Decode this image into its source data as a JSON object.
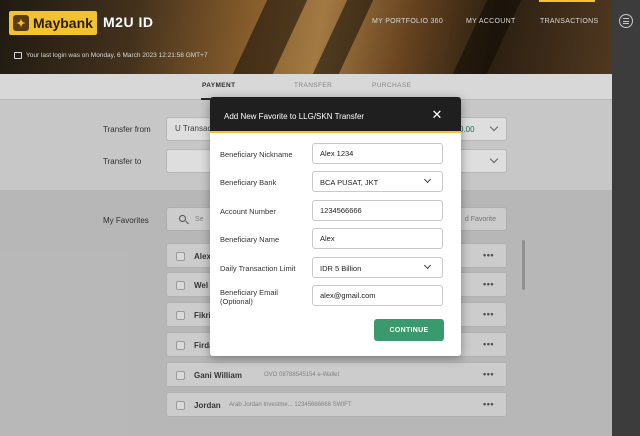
{
  "header": {
    "brand": "Maybank",
    "app_title": "M2U ID",
    "nav": [
      "MY PORTFOLIO 360",
      "MY ACCOUNT",
      "TRANSACTIONS"
    ],
    "last_login": "Your last login was on Monday, 6 March 2023 12:21:58 GMT+7"
  },
  "tabs": [
    "PAYMENT",
    "TRANSFER",
    "PURCHASE"
  ],
  "transfer_form": {
    "from_label": "Transfer from",
    "from_value": "U Transac",
    "balance_suffix": "0.00",
    "to_label": "Transfer to"
  },
  "favorites": {
    "label": "My Favorites",
    "search_placeholder": "Se",
    "add_link": "d Favorite",
    "items": [
      {
        "name": "Alex",
        "detail": ""
      },
      {
        "name": "Wel",
        "detail": ""
      },
      {
        "name": "Fikri",
        "detail": ""
      },
      {
        "name": "Firda",
        "detail": ""
      },
      {
        "name": "Gani William",
        "detail": "OVO 08788545154 e-Wallet"
      },
      {
        "name": "Jordan",
        "detail": "Arab Jordan Investme... 12345666666 SWIFT"
      }
    ]
  },
  "modal": {
    "title": "Add New Favorite to LLG/SKN Transfer",
    "close_icon": "close-icon",
    "fields": {
      "nickname_label": "Beneficiary Nickname",
      "nickname_value": "Alex 1234",
      "bank_label": "Beneficiary Bank",
      "bank_value": "BCA PUSAT, JKT",
      "account_label": "Account Number",
      "account_value": "1234566666",
      "name_label": "Beneficiary Name",
      "name_value": "Alex",
      "limit_label": "Daily Transaction Limit",
      "limit_value": "IDR 5 Billion",
      "email_label": "Beneficiary Email (Optional)",
      "email_value": "alex@gmail.com"
    },
    "continue_label": "CONTINUE"
  },
  "colors": {
    "brand_yellow": "#f2c230",
    "continue_green": "#3a9a6e",
    "modal_header": "#1f1f1f"
  }
}
